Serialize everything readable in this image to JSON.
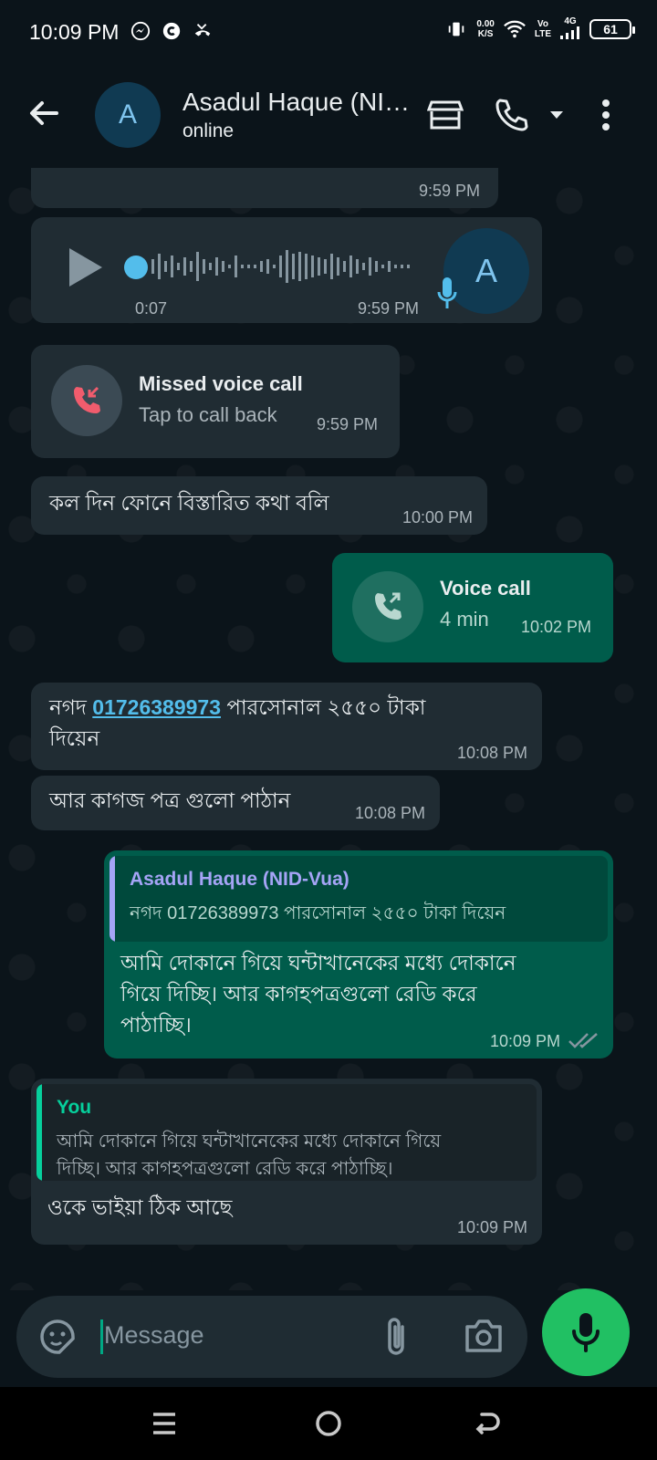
{
  "status_bar": {
    "time": "10:09 PM",
    "net_speed_top": "0.00",
    "net_speed_unit": "K/S",
    "volte_top": "Vo",
    "volte_bottom": "LTE",
    "network": "4G",
    "battery": "61"
  },
  "header": {
    "contact_name": "Asadul Haque (NI…",
    "status": "online",
    "avatar_letter": "A"
  },
  "messages": {
    "m1": {
      "time": "9:59 PM"
    },
    "voice": {
      "duration": "0:07",
      "time": "9:59 PM",
      "avatar_letter": "A"
    },
    "missed": {
      "title": "Missed voice call",
      "subtitle": "Tap to call back",
      "time": "9:59 PM"
    },
    "m3": {
      "text": "কল দিন ফোনে বিস্তারিত কথা বলি",
      "time": "10:00 PM"
    },
    "call": {
      "title": "Voice call",
      "subtitle": "4 min",
      "time": "10:02 PM"
    },
    "m5": {
      "prefix": "নগদ ",
      "link": "01726389973",
      "suffix": " পারসোনাল ২৫৫০ টাকা",
      "line2": "দিয়েন",
      "time": "10:08 PM"
    },
    "m6": {
      "text": "আর কাগজ পত্র গুলো পাঠান",
      "time": "10:08 PM"
    },
    "m7": {
      "quote_name": "Asadul Haque (NID-Vua)",
      "quote_text": "নগদ 01726389973 পারসোনাল ২৫৫০ টাকা দিয়েন",
      "line1": "আমি দোকানে গিয়ে ঘন্টাখানেকের মধ্যে দোকানে",
      "line2": "গিয়ে দিচ্ছি। আর কাগহপত্রগুলো রেডি করে",
      "line3": "পাঠাচ্ছি।",
      "time": "10:09 PM"
    },
    "m8": {
      "quote_name": "You",
      "quote_line1": "আমি দোকানে গিয়ে ঘন্টাখানেকের মধ্যে দোকানে গিয়ে",
      "quote_line2": "দিচ্ছি। আর কাগহপত্রগুলো রেডি করে পাঠাচ্ছি।",
      "text": "ওকে ভাইয়া ঠিক আছে",
      "time": "10:09 PM"
    }
  },
  "composer": {
    "placeholder": "Message"
  },
  "colors": {
    "bg": "#0b141a",
    "incoming": "#202c33",
    "outgoing": "#005c4b",
    "accent": "#21c063",
    "link": "#53bdeb"
  }
}
